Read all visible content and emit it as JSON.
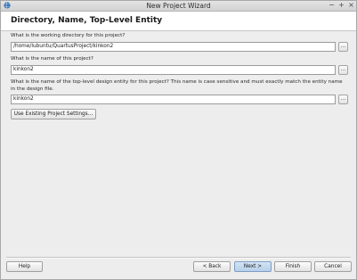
{
  "window": {
    "title": "New Project Wizard",
    "minimize": "−",
    "maximize": "+",
    "close": "×"
  },
  "header": {
    "title": "Directory, Name, Top-Level Entity"
  },
  "form": {
    "working_dir_label": "What is the working directory for this project?",
    "working_dir_value": "/home/lubuntu/QuartusProject/kinkon2",
    "project_name_label": "What is the name of this project?",
    "project_name_value": "kinkon2",
    "top_level_label": "What is the name of the top-level design entity for this project? This name is case sensitive and must exactly match the entity name in the design file.",
    "top_level_value": "kinkon2",
    "browse_label": "...",
    "use_existing_label": "Use Existing Project Settings..."
  },
  "footer": {
    "help": "Help",
    "back": "< Back",
    "next": "Next >",
    "finish": "Finish",
    "cancel": "Cancel"
  },
  "colors": {
    "window_bg": "#ededed",
    "header_bg": "#ffffff",
    "primary_button": "#b6cfe9",
    "icon_blue": "#2f6db5"
  },
  "icons": {
    "app": "quartus-globe-icon"
  }
}
